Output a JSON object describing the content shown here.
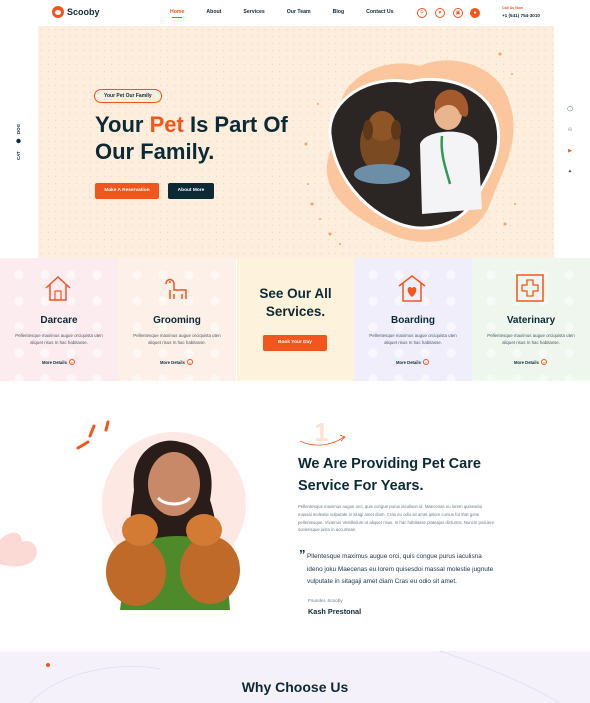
{
  "brand": {
    "name": "Scooby"
  },
  "nav": [
    {
      "label": "Home",
      "active": true
    },
    {
      "label": "About"
    },
    {
      "label": "Services"
    },
    {
      "label": "Our Team"
    },
    {
      "label": "Blog"
    },
    {
      "label": "Contact Us"
    }
  ],
  "header_icons": [
    "search-icon",
    "heart-icon",
    "cart-icon",
    "user-icon"
  ],
  "call": {
    "label": "Call Us Now",
    "number": "+1 (541) 754-3010"
  },
  "side_left": {
    "text": "CAT",
    "icon": "dog-icon",
    "extra": "DOG"
  },
  "social": [
    "instagram-icon",
    "pinterest-icon",
    "youtube-icon",
    "twitter-icon"
  ],
  "hero": {
    "tag": "Your Pet Our Family",
    "title_prefix": "Your ",
    "title_accent": "Pet",
    "title_suffix": " Is Part Of",
    "title_line2": "Our Family.",
    "primary_button": "Make A Reservation",
    "secondary_button": "About More"
  },
  "services": {
    "heading_line1": "See Our All",
    "heading_line2": "Services.",
    "book_button": "Book Your Day",
    "items": [
      {
        "title": "Darcare",
        "desc": "Pellentesque maximus augue orciquista uten aliquet risus In hac habitasse.",
        "link": "More Details",
        "icon": "house-icon",
        "color": "#fdecef"
      },
      {
        "title": "Grooming",
        "desc": "Pellentesque maximus augue orciquista uten aliquet risus In hac habitasse.",
        "link": "More Details",
        "icon": "dog-grooming-icon",
        "color": "#fdf0e8"
      },
      {
        "title": "Boarding",
        "desc": "Pellentesque maximus augue orciquista uten aliquet risus In hac habitasse.",
        "link": "More Details",
        "icon": "pet-house-icon",
        "color": "#f1eefb"
      },
      {
        "title": "Vaterinary",
        "desc": "Pellentesque maximus augue orciquista uten aliquet risus In hac habitasse.",
        "link": "More Details",
        "icon": "medical-cross-icon",
        "color": "#eef6ee"
      }
    ]
  },
  "about": {
    "number": "1",
    "title_line1": "We Are Providing Pet Care",
    "title_line2": "Service For Years.",
    "text": "Pellentesque maximus augue orci, quis congue purus iaculison id. Maecenas eu lorem quisesdoi massal molestie vulputate in sitagi amet diam. Cras eu odio sit amet ipsum cursus for that gone pellentesque. Vivamus Vestibulum ut aliquet risus. In hac habitasse plateajus dictumst. Nuncin posuere scelerisque justo in accumsan.",
    "quote": "Pllentesque maximus augue orci, quis congue purus iaculisna ideno joku Maecenas eu lorem quisesdoi massal molestie jugnute vulputate in sitagaji amet diam Cras eu odio sit amet.",
    "founder_role": "Founder, Scooby",
    "founder_name": "Kash Prestonal"
  },
  "why": {
    "title": "Why Choose Us"
  },
  "colors": {
    "accent": "#f2561d",
    "dark": "#0c2a36",
    "hero_bg": "#fdeedd",
    "center_card": "#fdf3dc"
  }
}
